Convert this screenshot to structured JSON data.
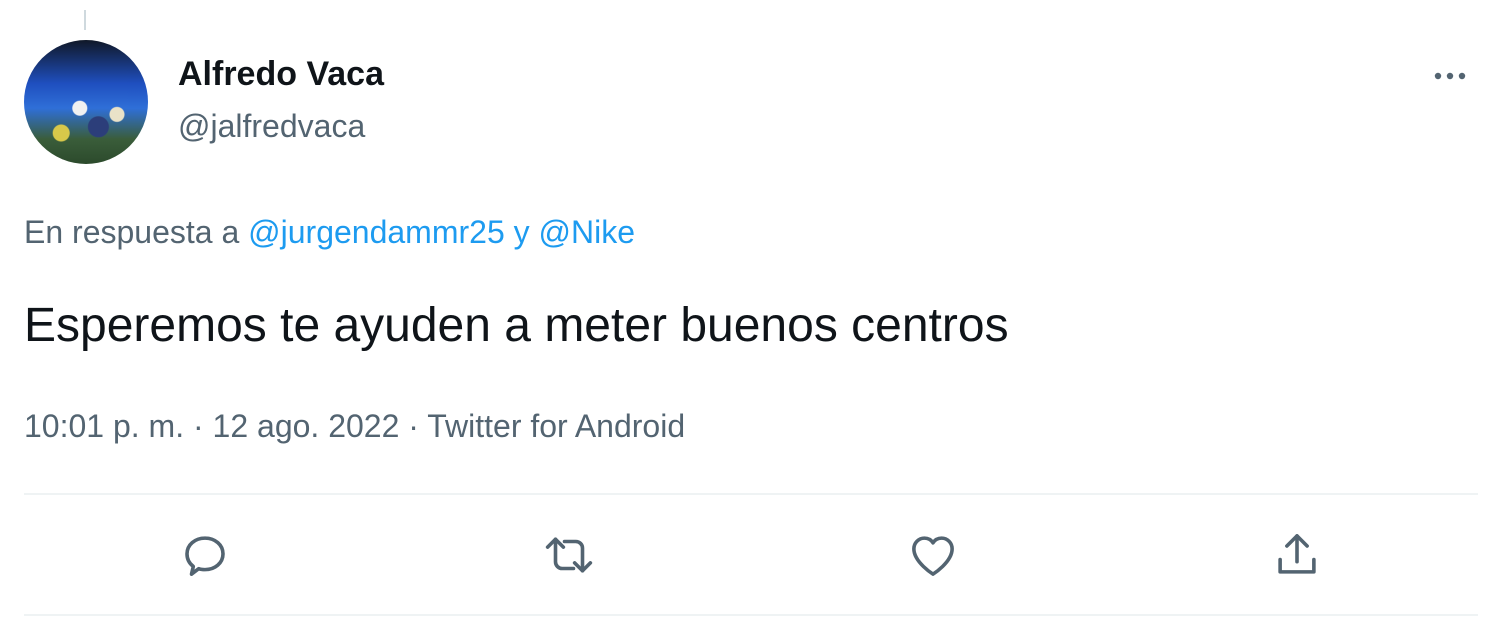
{
  "tweet": {
    "author": {
      "display_name": "Alfredo Vaca",
      "handle": "@jalfredvaca"
    },
    "reply_prefix": "En respuesta a",
    "reply_mentions": [
      "@jurgendammr25",
      "@Nike"
    ],
    "reply_joiner": "y",
    "text": "Esperemos te ayuden a meter buenos centros",
    "time": "10:01 p. m.",
    "date": "12 ago. 2022",
    "separator": "·",
    "source": "Twitter for Android"
  },
  "actions": {
    "reply_icon": "reply-icon",
    "retweet_icon": "retweet-icon",
    "like_icon": "like-icon",
    "share_icon": "share-icon",
    "more_icon": "more-icon"
  },
  "colors": {
    "primary_text": "#0f1419",
    "secondary_text": "#536471",
    "accent": "#1d9bf0",
    "divider": "#eff3f4"
  }
}
